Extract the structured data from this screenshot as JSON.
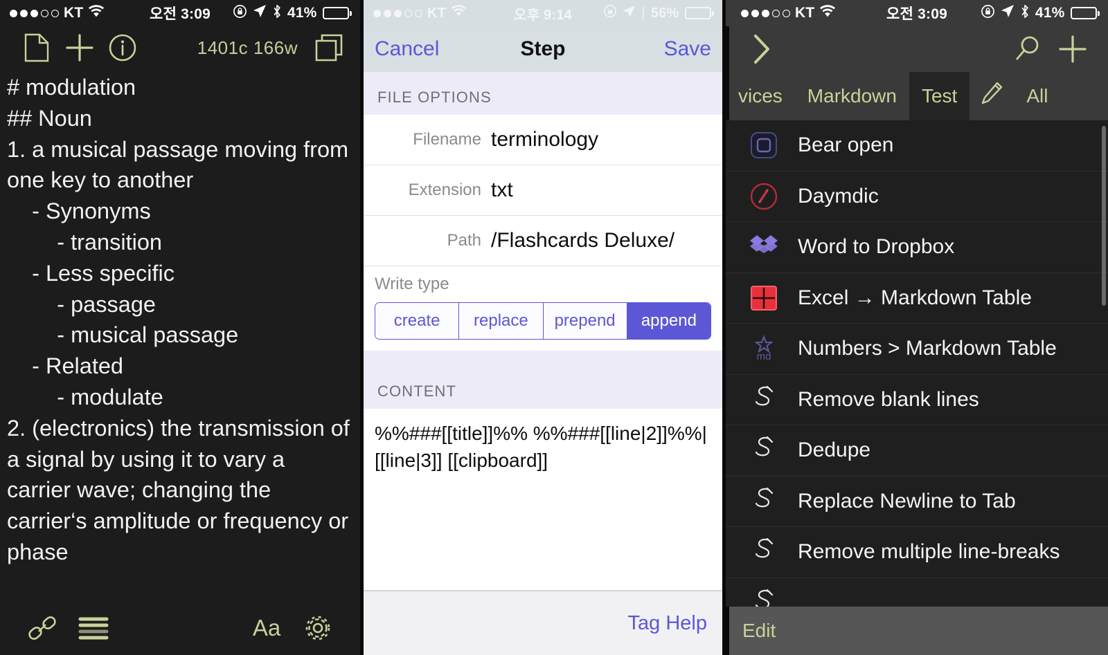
{
  "left_panel": {
    "status_bar": {
      "carrier": "KT",
      "signal_dots_filled": 3,
      "signal_dots_empty": 2,
      "wifi_icon": "wifi-icon",
      "time": "오전 3:09",
      "lock_icon": "rotation-lock-icon",
      "location_icon": "location-arrow-icon",
      "bluetooth_icon": "bluetooth-icon",
      "battery_percent": "41%",
      "battery_level": 41
    },
    "toolbar": {
      "new_note_icon": "document-icon",
      "add_icon": "plus-icon",
      "info_icon": "info-circle-icon",
      "word_count": "1401c 166w",
      "preview_icon": "copy-window-icon"
    },
    "note_text": "# modulation\n## Noun\n1. a musical passage moving from one key to another\n    - Synonyms\n        - transition\n    - Less specific\n        - passage\n        - musical passage\n    - Related\n        - modulate\n2. (electronics) the transmission of a signal by using it to vary a carrier wave; changing the carrier‘s amplitude or frequency or phase",
    "bottom_bar": {
      "link_icon": "paperclip-link-icon",
      "menu_icon": "hamburger-menu-icon",
      "font_label": "Aa",
      "settings_icon": "gear-icon"
    }
  },
  "middle_panel": {
    "status_bar": {
      "carrier": "KT",
      "signal_dots_filled": 3,
      "signal_dots_empty": 2,
      "wifi_icon": "wifi-icon",
      "time": "오후 9:14",
      "lock_icon": "rotation-lock-icon",
      "location_icon": "location-arrow-icon",
      "battery_percent": "56%",
      "battery_level": 56
    },
    "navbar": {
      "cancel_label": "Cancel",
      "title": "Step",
      "save_label": "Save"
    },
    "file_options": {
      "header": "FILE OPTIONS",
      "rows": [
        {
          "label": "Filename",
          "value": "terminology"
        },
        {
          "label": "Extension",
          "value": "txt"
        },
        {
          "label": "Path",
          "value": "/Flashcards Deluxe/"
        }
      ]
    },
    "write_type": {
      "label": "Write type",
      "options": [
        "create",
        "replace",
        "prepend",
        "append"
      ],
      "selected": "append"
    },
    "content": {
      "header": "CONTENT",
      "value": "%%###[[title]]%% %%###[[line|2]]%%|[[line|3]]    [[clipboard]]"
    },
    "bottom_bar": {
      "tag_help_label": "Tag Help"
    },
    "accent_color": "#5b57d6"
  },
  "right_panel": {
    "status_bar": {
      "carrier": "KT",
      "signal_dots_filled": 3,
      "signal_dots_empty": 2,
      "wifi_icon": "wifi-icon",
      "time": "오전 3:09",
      "lock_icon": "rotation-lock-icon",
      "location_icon": "location-arrow-icon",
      "bluetooth_icon": "bluetooth-icon",
      "battery_percent": "41%",
      "battery_level": 41
    },
    "toolbar": {
      "expand_icon": "chevron-right-icon",
      "search_icon": "magnifier-icon",
      "add_icon": "plus-icon"
    },
    "tabs": [
      {
        "label": "vices",
        "active": false,
        "type": "text"
      },
      {
        "label": "Markdown",
        "active": false,
        "type": "text"
      },
      {
        "label": "Test",
        "active": true,
        "type": "text"
      },
      {
        "label": "",
        "active": false,
        "type": "icon",
        "icon": "pencil-icon"
      },
      {
        "label": "All",
        "active": false,
        "type": "text"
      }
    ],
    "list_items": [
      {
        "label": "Bear open",
        "icon": "bear-app-icon",
        "icon_color": "#3b3a6e"
      },
      {
        "label": "Daymdic",
        "icon": "daymdic-app-icon",
        "icon_color": "#b62a3a"
      },
      {
        "label": "Word to Dropbox",
        "icon": "dropbox-icon",
        "icon_color": "#8a7ae0"
      },
      {
        "label": "Excel → Markdown Table",
        "icon": "excel-table-icon",
        "icon_color": "#e8303c"
      },
      {
        "label": "Numbers > Markdown Table",
        "icon": "md-star-icon",
        "icon_color": "#4b4b8a"
      },
      {
        "label": "Remove blank lines",
        "icon": "script-s-icon",
        "icon_color": "#e8e8e8"
      },
      {
        "label": "Dedupe",
        "icon": "script-s-icon",
        "icon_color": "#e8e8e8"
      },
      {
        "label": "Replace Newline to Tab",
        "icon": "script-s-icon",
        "icon_color": "#e8e8e8"
      },
      {
        "label": "Remove multiple line-breaks",
        "icon": "script-s-icon",
        "icon_color": "#e8e8e8"
      }
    ],
    "bottom_bar": {
      "edit_label": "Edit"
    },
    "accent_color": "#ccd09a"
  }
}
